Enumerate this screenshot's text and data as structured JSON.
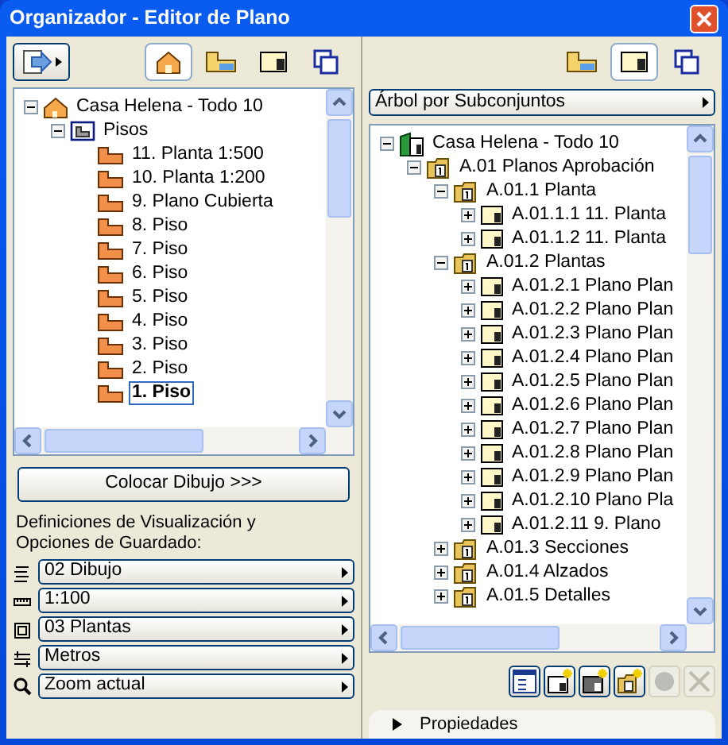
{
  "window": {
    "title": "Organizador - Editor de Plano"
  },
  "left_panel": {
    "view_buttons": [
      {
        "kind": "project",
        "selected": true
      },
      {
        "kind": "views",
        "selected": false
      },
      {
        "kind": "layouts",
        "selected": false
      },
      {
        "kind": "publisher",
        "selected": false
      }
    ],
    "tree": [
      {
        "label": "Casa Helena - Todo 10",
        "kind": "house",
        "expanded": true,
        "selected": false,
        "children": [
          {
            "label": "Pisos",
            "kind": "stories",
            "expanded": true,
            "selected": false,
            "children": [
              {
                "label": "11. Planta 1:500",
                "kind": "story",
                "selected": false
              },
              {
                "label": "10. Planta 1:200",
                "kind": "story",
                "selected": false
              },
              {
                "label": "9. Plano Cubierta",
                "kind": "story",
                "selected": false
              },
              {
                "label": "8. Piso",
                "kind": "story",
                "selected": false
              },
              {
                "label": "7. Piso",
                "kind": "story",
                "selected": false
              },
              {
                "label": "6. Piso",
                "kind": "story",
                "selected": false
              },
              {
                "label": "5. Piso",
                "kind": "story",
                "selected": false
              },
              {
                "label": "4. Piso",
                "kind": "story",
                "selected": false
              },
              {
                "label": "3. Piso",
                "kind": "story",
                "selected": false
              },
              {
                "label": "2. Piso",
                "kind": "story",
                "selected": false
              },
              {
                "label": "1. Piso",
                "kind": "story",
                "selected": true
              }
            ]
          }
        ]
      }
    ],
    "place_button": "Colocar Dibujo >>>",
    "settings_label": "Definiciones de Visualización y Opciones de Guardado:",
    "settings": [
      {
        "kind": "layers",
        "value": "02 Dibujo"
      },
      {
        "kind": "scale",
        "value": "1:100"
      },
      {
        "kind": "structure",
        "value": "03 Plantas"
      },
      {
        "kind": "units",
        "value": "Metros"
      },
      {
        "kind": "zoom",
        "value": "Zoom actual"
      }
    ]
  },
  "right_panel": {
    "view_buttons": [
      {
        "kind": "views",
        "selected": false
      },
      {
        "kind": "layouts",
        "selected": true
      },
      {
        "kind": "publisher",
        "selected": false
      }
    ],
    "tree_mode": "Árbol por Subconjuntos",
    "tree": [
      {
        "label": "Casa Helena - Todo 10",
        "kind": "book",
        "expanded": true,
        "selected": false,
        "children": [
          {
            "label": "A.01 Planos Aprobación",
            "kind": "subset",
            "expanded": true,
            "selected": false,
            "children": [
              {
                "label": "A.01.1 Planta",
                "kind": "subset",
                "expanded": true,
                "selected": false,
                "children": [
                  {
                    "label": "A.01.1.1 11. Planta",
                    "kind": "layout",
                    "expanded": false,
                    "selected": false
                  },
                  {
                    "label": "A.01.1.2 11. Planta",
                    "kind": "layout",
                    "expanded": false,
                    "selected": false
                  }
                ]
              },
              {
                "label": "A.01.2 Plantas",
                "kind": "subset",
                "expanded": true,
                "selected": false,
                "children": [
                  {
                    "label": "A.01.2.1 Plano Plan",
                    "kind": "layout",
                    "expanded": false,
                    "selected": false
                  },
                  {
                    "label": "A.01.2.2 Plano Plan",
                    "kind": "layout",
                    "expanded": false,
                    "selected": false
                  },
                  {
                    "label": "A.01.2.3 Plano Plan",
                    "kind": "layout",
                    "expanded": false,
                    "selected": false
                  },
                  {
                    "label": "A.01.2.4 Plano Plan",
                    "kind": "layout",
                    "expanded": false,
                    "selected": false
                  },
                  {
                    "label": "A.01.2.5 Plano Plan",
                    "kind": "layout",
                    "expanded": false,
                    "selected": false
                  },
                  {
                    "label": "A.01.2.6 Plano Plan",
                    "kind": "layout",
                    "expanded": false,
                    "selected": false
                  },
                  {
                    "label": "A.01.2.7 Plano Plan",
                    "kind": "layout",
                    "expanded": false,
                    "selected": false
                  },
                  {
                    "label": "A.01.2.8 Plano Plan",
                    "kind": "layout",
                    "expanded": false,
                    "selected": false
                  },
                  {
                    "label": "A.01.2.9 Plano Plan",
                    "kind": "layout",
                    "expanded": false,
                    "selected": false
                  },
                  {
                    "label": "A.01.2.10 Plano Pla",
                    "kind": "layout",
                    "expanded": false,
                    "selected": false
                  },
                  {
                    "label": "A.01.2.11 9. Plano",
                    "kind": "layout",
                    "expanded": false,
                    "selected": false
                  }
                ]
              },
              {
                "label": "A.01.3 Secciones",
                "kind": "subset",
                "expanded": false,
                "selected": false
              },
              {
                "label": "A.01.4 Alzados",
                "kind": "subset",
                "expanded": false,
                "selected": false
              },
              {
                "label": "A.01.5 Detalles",
                "kind": "subset",
                "expanded": false,
                "selected": false
              }
            ]
          }
        ]
      }
    ],
    "actions": [
      {
        "kind": "settings",
        "disabled": false
      },
      {
        "kind": "new-layout",
        "disabled": false
      },
      {
        "kind": "new-master",
        "disabled": false
      },
      {
        "kind": "new-subset",
        "disabled": false
      },
      {
        "kind": "record",
        "disabled": true
      },
      {
        "kind": "delete",
        "disabled": true
      }
    ],
    "properties": {
      "label": "Propiedades",
      "expanded": false
    }
  }
}
